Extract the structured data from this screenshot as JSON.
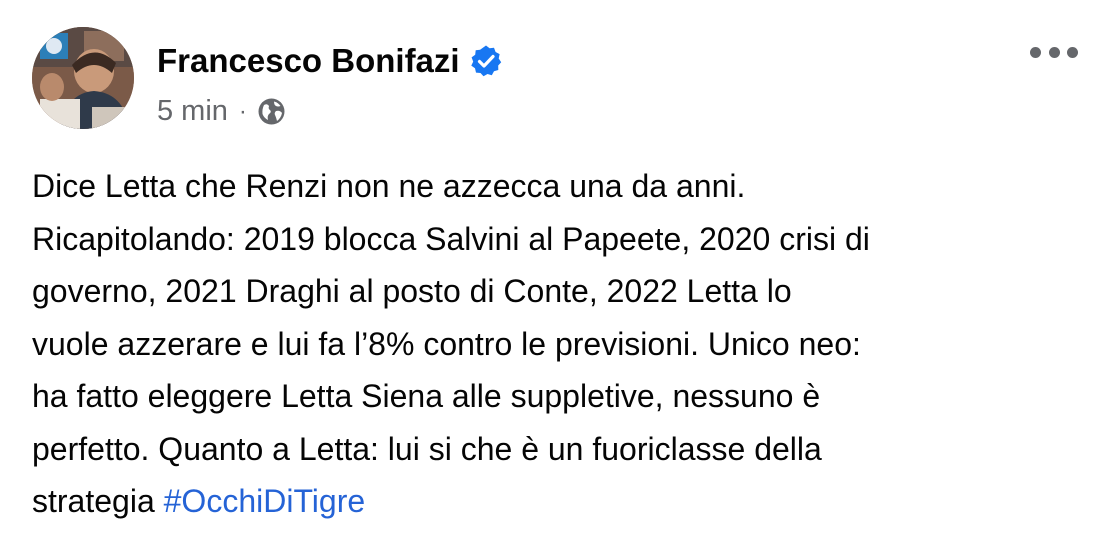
{
  "post": {
    "author": "Francesco Bonifazi",
    "time": "5 min",
    "separator": "·",
    "audience_icon": "globe-icon",
    "verified_icon": "verified-badge-icon",
    "more_icon": "more-options-icon",
    "text_lines": [
      "Dice Letta che Renzi non ne azzecca una da anni.",
      "Ricapitolando: 2019 blocca Salvini al Papeete, 2020 crisi di",
      "governo, 2021 Draghi al posto di Conte, 2022 Letta lo",
      "vuole azzerare e lui fa l’8% contro le previsioni. Unico neo:",
      "ha fatto eleggere Letta Siena alle suppletive, nessuno è",
      "perfetto. Quanto a Letta: lui si che è un fuoriclasse della"
    ],
    "last_line_text": "strategia ",
    "hashtag": "#OcchiDiTigre"
  },
  "colors": {
    "text": "#050505",
    "secondary": "#65676b",
    "link": "#2563d6",
    "verified": "#1877f2"
  }
}
